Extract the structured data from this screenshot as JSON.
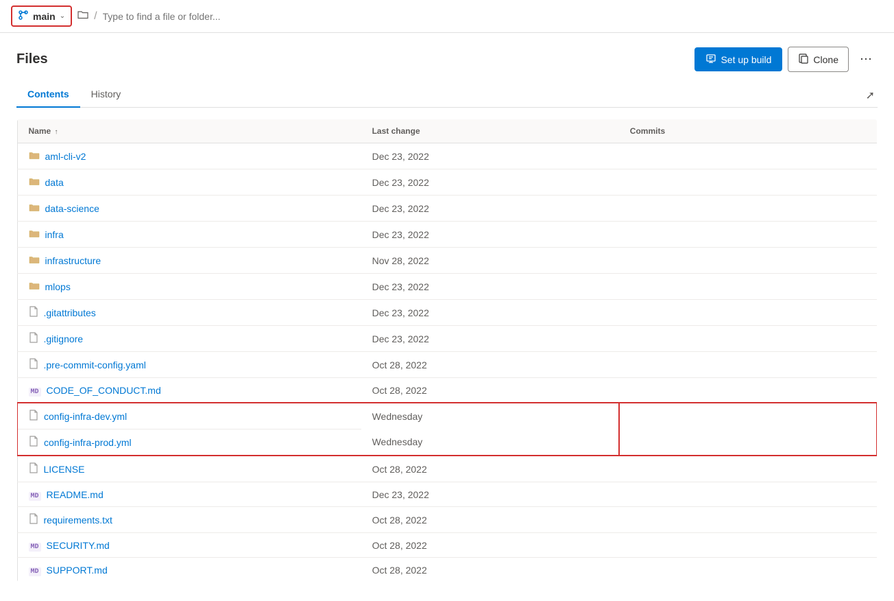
{
  "topbar": {
    "branch": "main",
    "search_placeholder": "Type to find a file or folder..."
  },
  "header": {
    "title": "Files",
    "setup_build_label": "Set up build",
    "clone_label": "Clone"
  },
  "tabs": [
    {
      "id": "contents",
      "label": "Contents",
      "active": true
    },
    {
      "id": "history",
      "label": "History",
      "active": false
    }
  ],
  "table": {
    "columns": [
      {
        "key": "name",
        "label": "Name",
        "sortable": true,
        "sort_direction": "asc"
      },
      {
        "key": "last_change",
        "label": "Last change"
      },
      {
        "key": "commits",
        "label": "Commits"
      }
    ],
    "rows": [
      {
        "id": "aml-cli-v2",
        "name": "aml-cli-v2",
        "type": "folder",
        "last_change": "Dec 23, 2022",
        "commits": "",
        "highlighted": false
      },
      {
        "id": "data",
        "name": "data",
        "type": "folder",
        "last_change": "Dec 23, 2022",
        "commits": "",
        "highlighted": false
      },
      {
        "id": "data-science",
        "name": "data-science",
        "type": "folder",
        "last_change": "Dec 23, 2022",
        "commits": "",
        "highlighted": false
      },
      {
        "id": "infra",
        "name": "infra",
        "type": "folder",
        "last_change": "Dec 23, 2022",
        "commits": "",
        "highlighted": false
      },
      {
        "id": "infrastructure",
        "name": "infrastructure",
        "type": "folder",
        "last_change": "Nov 28, 2022",
        "commits": "",
        "highlighted": false
      },
      {
        "id": "mlops",
        "name": "mlops",
        "type": "folder",
        "last_change": "Dec 23, 2022",
        "commits": "",
        "highlighted": false
      },
      {
        "id": "gitattributes",
        "name": ".gitattributes",
        "type": "file",
        "last_change": "Dec 23, 2022",
        "commits": "",
        "highlighted": false
      },
      {
        "id": "gitignore",
        "name": ".gitignore",
        "type": "file",
        "last_change": "Dec 23, 2022",
        "commits": "",
        "highlighted": false
      },
      {
        "id": "pre-commit-config",
        "name": ".pre-commit-config.yaml",
        "type": "file",
        "last_change": "Oct 28, 2022",
        "commits": "",
        "highlighted": false
      },
      {
        "id": "CODE_OF_CONDUCT",
        "name": "CODE_OF_CONDUCT.md",
        "type": "file-md",
        "last_change": "Oct 28, 2022",
        "commits": "",
        "highlighted": false
      },
      {
        "id": "config-infra-dev",
        "name": "config-infra-dev.yml",
        "type": "file",
        "last_change": "Wednesday",
        "commits": "",
        "highlighted": true
      },
      {
        "id": "config-infra-prod",
        "name": "config-infra-prod.yml",
        "type": "file",
        "last_change": "Wednesday",
        "commits": "",
        "highlighted": true
      },
      {
        "id": "LICENSE",
        "name": "LICENSE",
        "type": "file",
        "last_change": "Oct 28, 2022",
        "commits": "",
        "highlighted": false
      },
      {
        "id": "README",
        "name": "README.md",
        "type": "file-md",
        "last_change": "Dec 23, 2022",
        "commits": "",
        "highlighted": false
      },
      {
        "id": "requirements",
        "name": "requirements.txt",
        "type": "file",
        "last_change": "Oct 28, 2022",
        "commits": "",
        "highlighted": false
      },
      {
        "id": "SECURITY",
        "name": "SECURITY.md",
        "type": "file-md",
        "last_change": "Oct 28, 2022",
        "commits": "",
        "highlighted": false
      },
      {
        "id": "SUPPORT",
        "name": "SUPPORT.md",
        "type": "file-md",
        "last_change": "Oct 28, 2022",
        "commits": "",
        "highlighted": false
      }
    ]
  },
  "icons": {
    "branch": "⑂",
    "chevron_down": "∨",
    "folder_open": "📁",
    "expand": "⤢",
    "setup_build_icon": "⬡",
    "clone_icon": "⎘",
    "more_icon": "⋯"
  }
}
